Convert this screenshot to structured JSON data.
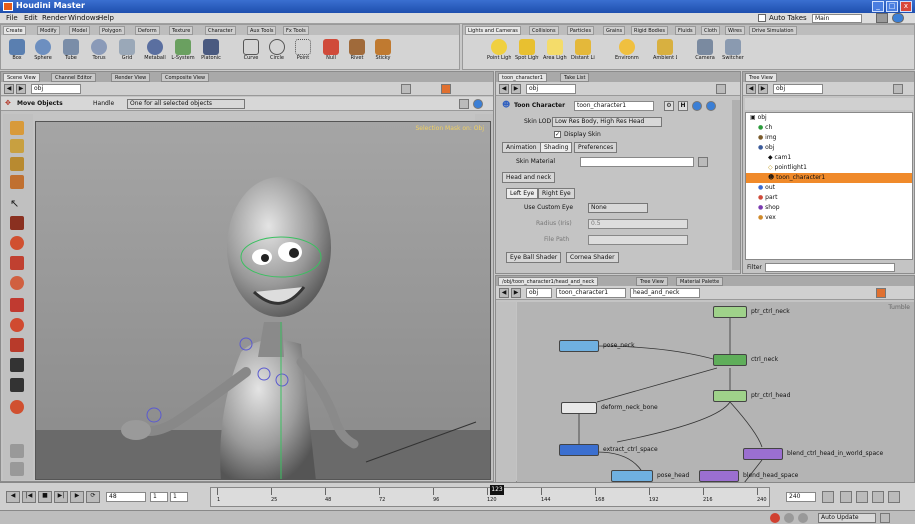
{
  "app": {
    "title": "Houdini Master",
    "min": "_",
    "max": "□",
    "close": "x"
  },
  "menu": [
    "File",
    "Edit",
    "Render",
    "Windows",
    "Help"
  ],
  "auto_takes_label": "Auto Takes",
  "take_value": "Main",
  "shelf_left": {
    "tabs": [
      "Create",
      "Modify",
      "Model",
      "Polygon",
      "Deform",
      "Texture",
      "Character",
      "Aux Tools",
      "Fx Tools"
    ],
    "tools": [
      "Box",
      "Sphere",
      "Tube",
      "Torus",
      "Grid",
      "Metaball",
      "L-System",
      "Platonic",
      "Curve",
      "Circle",
      "Point",
      "Null",
      "Rivet",
      "Sticky"
    ]
  },
  "shelf_right": {
    "tabs": [
      "Lights and Cameras",
      "Collisions",
      "Particles",
      "Grains",
      "Rigid Bodies",
      "Fluids",
      "Cloth",
      "Wires",
      "Drive Simulation"
    ],
    "tools": [
      "Point Light",
      "Spot Light",
      "Area Light",
      "Distant Li...",
      "Environm...",
      "Ambient L...",
      "Camera",
      "Switcher"
    ]
  },
  "scene_panel": {
    "tabs": [
      "Scene View",
      "Channel Editor",
      "Render View",
      "Composite View"
    ],
    "path": "obj",
    "state_title": "Move Objects",
    "handle_label": "Handle",
    "handle_value": "One for all selected objects",
    "corner_note": "Selection Mask on: Obj"
  },
  "param_panel": {
    "tabs": [
      "toon_character1",
      "Take List"
    ],
    "path": "obj",
    "node_type": "Toon Character",
    "node_name": "toon_character1",
    "skin_lod_label": "Skin LOD",
    "skin_lod_value": "Low Res Body, High Res Head",
    "display_skin": "Display Skin",
    "subtabs": [
      "Animation",
      "Shading",
      "Preferences"
    ],
    "skin_material_label": "Skin Material",
    "head_and_neck": "Head and neck",
    "eye_tabs": [
      "Left Eye",
      "Right Eye"
    ],
    "custom_eye_label": "Use Custom Eye",
    "custom_eye_value": "None",
    "iris_label": "Radius (Iris)",
    "iris_value": "0.5",
    "file_path_label": "File Path",
    "eye_ball_shader": "Eye Ball Shader",
    "cornea_shader": "Cornea Shader"
  },
  "tree_panel": {
    "tabs": [
      "Tree View"
    ],
    "path": "obj",
    "items": [
      {
        "label": "obj",
        "depth": 0
      },
      {
        "label": "ch",
        "depth": 1
      },
      {
        "label": "img",
        "depth": 1
      },
      {
        "label": "obj",
        "depth": 1
      },
      {
        "label": "cam1",
        "depth": 2
      },
      {
        "label": "pointlight1",
        "depth": 2
      },
      {
        "label": "toon_character1",
        "depth": 2,
        "selected": true
      },
      {
        "label": "out",
        "depth": 1
      },
      {
        "label": "part",
        "depth": 1
      },
      {
        "label": "shop",
        "depth": 1
      },
      {
        "label": "vex",
        "depth": 1
      }
    ],
    "filter_label": "Filter"
  },
  "network_panel": {
    "tabs": [
      "/obj/toon_character1/head_and_neck",
      "Tree View",
      "Material Palette"
    ],
    "path_parts": [
      "obj",
      "toon_character1",
      "head_and_neck"
    ],
    "corner": "Tumble",
    "nodes": [
      {
        "label": "ptr_ctrl_neck",
        "color": "#9fd28a"
      },
      {
        "label": "pose_neck",
        "color": "#6fb0e0"
      },
      {
        "label": "ctrl_neck",
        "color": "#5fae5a"
      },
      {
        "label": "ptr_ctrl_head",
        "color": "#9fd28a"
      },
      {
        "label": "deform_neck_bone",
        "color": "#e8e8e8"
      },
      {
        "label": "extract_ctrl_space",
        "color": "#3b6fd0"
      },
      {
        "label": "blend_ctrl_head_in_world_space",
        "color": "#9b6fd0"
      },
      {
        "label": "pose_head",
        "color": "#6fb0e0"
      },
      {
        "label": "blend_head_space",
        "color": "#9b6fd0"
      }
    ]
  },
  "timeline": {
    "frame_start": "1",
    "frame_end": "1",
    "fps_field": "48",
    "current_frame": "123",
    "ticks": [
      "1",
      "25",
      "48",
      "72",
      "96",
      "120",
      "144",
      "168",
      "192",
      "216",
      "240"
    ],
    "end_frame": "240",
    "current_position": 0.51
  },
  "status": {
    "update_mode": "Auto Update"
  }
}
